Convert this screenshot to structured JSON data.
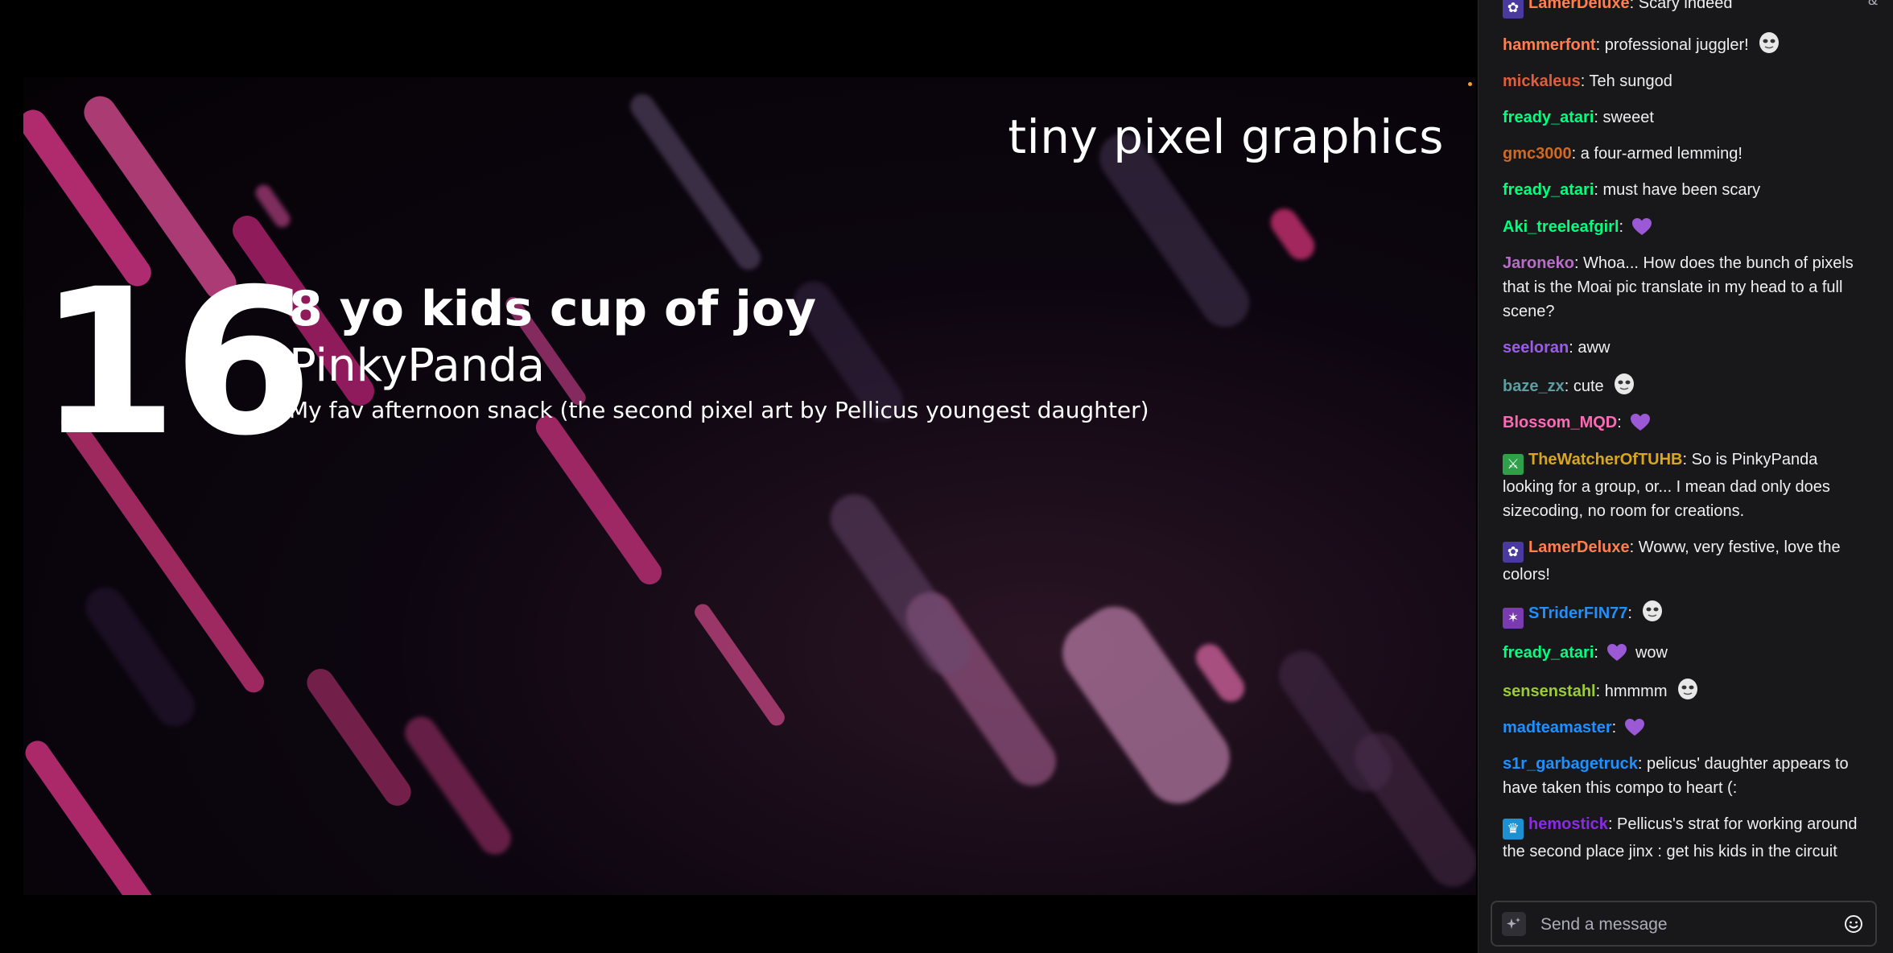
{
  "stream": {
    "overlay_caption": "tiny pixel graphics",
    "entry_number": "16",
    "entry_title": "8 yo kids cup of joy",
    "entry_author": "PinkyPanda",
    "entry_description": "My fav afternoon snack (the second pixel art by Pellicus youngest daughter)"
  },
  "chat": {
    "top_glyph": "^&",
    "messages": [
      {
        "user": "LamerDeluxe",
        "text": ": Scary indeed",
        "color": "#ff7f50",
        "badge": "tulip",
        "emote": null
      },
      {
        "user": "hammerfont",
        "text": ": professional juggler!",
        "color": "#ff7f50",
        "badge": null,
        "emote": "face"
      },
      {
        "user": "mickaleus",
        "text": ": Teh sungod",
        "color": "#e25d3b",
        "badge": null,
        "emote": null
      },
      {
        "user": "fready_atari",
        "text": ": sweeet",
        "color": "#00ff7f",
        "badge": null,
        "emote": null
      },
      {
        "user": "gmc3000",
        "text": ": a four-armed lemming!",
        "color": "#d2691e",
        "badge": null,
        "emote": null
      },
      {
        "user": "fready_atari",
        "text": ": must have been scary",
        "color": "#00ff7f",
        "badge": null,
        "emote": null
      },
      {
        "user": "Aki_treeleafgirl",
        "text": ":",
        "color": "#00ff7f",
        "badge": null,
        "emote": "heart"
      },
      {
        "user": "Jaroneko",
        "text": ": Whoa... How does the bunch of pixels that is the Moai pic translate in my head to a full scene?",
        "color": "#b86ec8",
        "badge": null,
        "emote": null
      },
      {
        "user": "seeloran",
        "text": ": aww",
        "color": "#9b5de5",
        "badge": null,
        "emote": null
      },
      {
        "user": "baze_zx",
        "text": ": cute",
        "color": "#5f9ea0",
        "badge": null,
        "emote": "face"
      },
      {
        "user": "Blossom_MQD",
        "text": ":",
        "color": "#ff69b4",
        "badge": null,
        "emote": "heart"
      },
      {
        "user": "TheWatcherOfTUHB",
        "text": ": So is PinkyPanda looking for a group, or... I mean dad only does sizecoding, no room for creations.",
        "color": "#daa520",
        "badge": "sword",
        "emote": null
      },
      {
        "user": "LamerDeluxe",
        "text": ": Woww, very festive, love the colors!",
        "color": "#ff7f50",
        "badge": "tulip",
        "emote": null
      },
      {
        "user": "STriderFIN77",
        "text": ":",
        "color": "#1e90ff",
        "badge": "sub",
        "emote": "face"
      },
      {
        "user": "fready_atari",
        "text": ":",
        "color": "#00ff7f",
        "badge": null,
        "emote": "heart",
        "after": "wow"
      },
      {
        "user": "sensenstahl",
        "text": ": hmmmm",
        "color": "#9acd32",
        "badge": null,
        "emote": "face"
      },
      {
        "user": "madteamaster",
        "text": ":",
        "color": "#1e90ff",
        "badge": null,
        "emote": "heart"
      },
      {
        "user": "s1r_garbagetruck",
        "text": ": pelicus' daughter appears to have taken this compo to heart (:",
        "color": "#1e90ff",
        "badge": null,
        "emote": null
      },
      {
        "user": "hemostick",
        "text": ": Pellicus's strat for working around the second place jinx : get his kids in the circuit",
        "color": "#8a2be2",
        "badge": "crown",
        "emote": null
      }
    ],
    "input": {
      "placeholder": "Send a message"
    },
    "icons": {
      "input_left": "sparkle-icon",
      "input_right": "smiley-icon"
    }
  }
}
